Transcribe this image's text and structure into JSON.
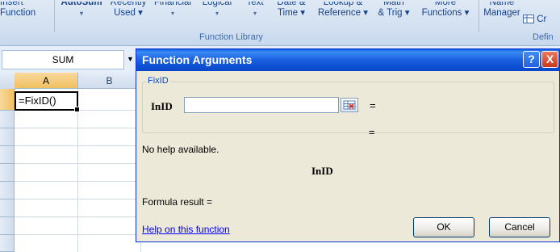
{
  "ribbon": {
    "items": [
      {
        "line1": "Insert",
        "line2": "Function"
      },
      {
        "line1": "AutoSum",
        "line2": "▾"
      },
      {
        "line1": "Recently",
        "line2": "Used ▾"
      },
      {
        "line1": "Financial",
        "line2": "▾"
      },
      {
        "line1": "Logical",
        "line2": "▾"
      },
      {
        "line1": "Text",
        "line2": "▾"
      },
      {
        "line1": "Date &",
        "line2": "Time ▾"
      },
      {
        "line1": "Lookup &",
        "line2": "Reference ▾"
      },
      {
        "line1": "Math",
        "line2": "& Trig ▾"
      },
      {
        "line1": "More",
        "line2": "Functions ▾"
      },
      {
        "line1": "Name",
        "line2": "Manager"
      }
    ],
    "create_label": "Cr",
    "group_function_library": "Function Library",
    "group_defined_names": "Defin"
  },
  "name_box": {
    "value": "SUM"
  },
  "sheet": {
    "columns": [
      "A",
      "B"
    ],
    "active_cell_value": "=FixID()"
  },
  "dialog": {
    "title": "Function Arguments",
    "help_button": "?",
    "close_button": "X",
    "function_name": "FixID",
    "argument_label": "InID",
    "argument_value": "",
    "equals_1": "=",
    "equals_2": "=",
    "no_help_text": "No help available.",
    "argument_description_label": "InID",
    "formula_result_label": "Formula result =",
    "help_link": "Help on this function",
    "ok_label": "OK",
    "cancel_label": "Cancel"
  }
}
